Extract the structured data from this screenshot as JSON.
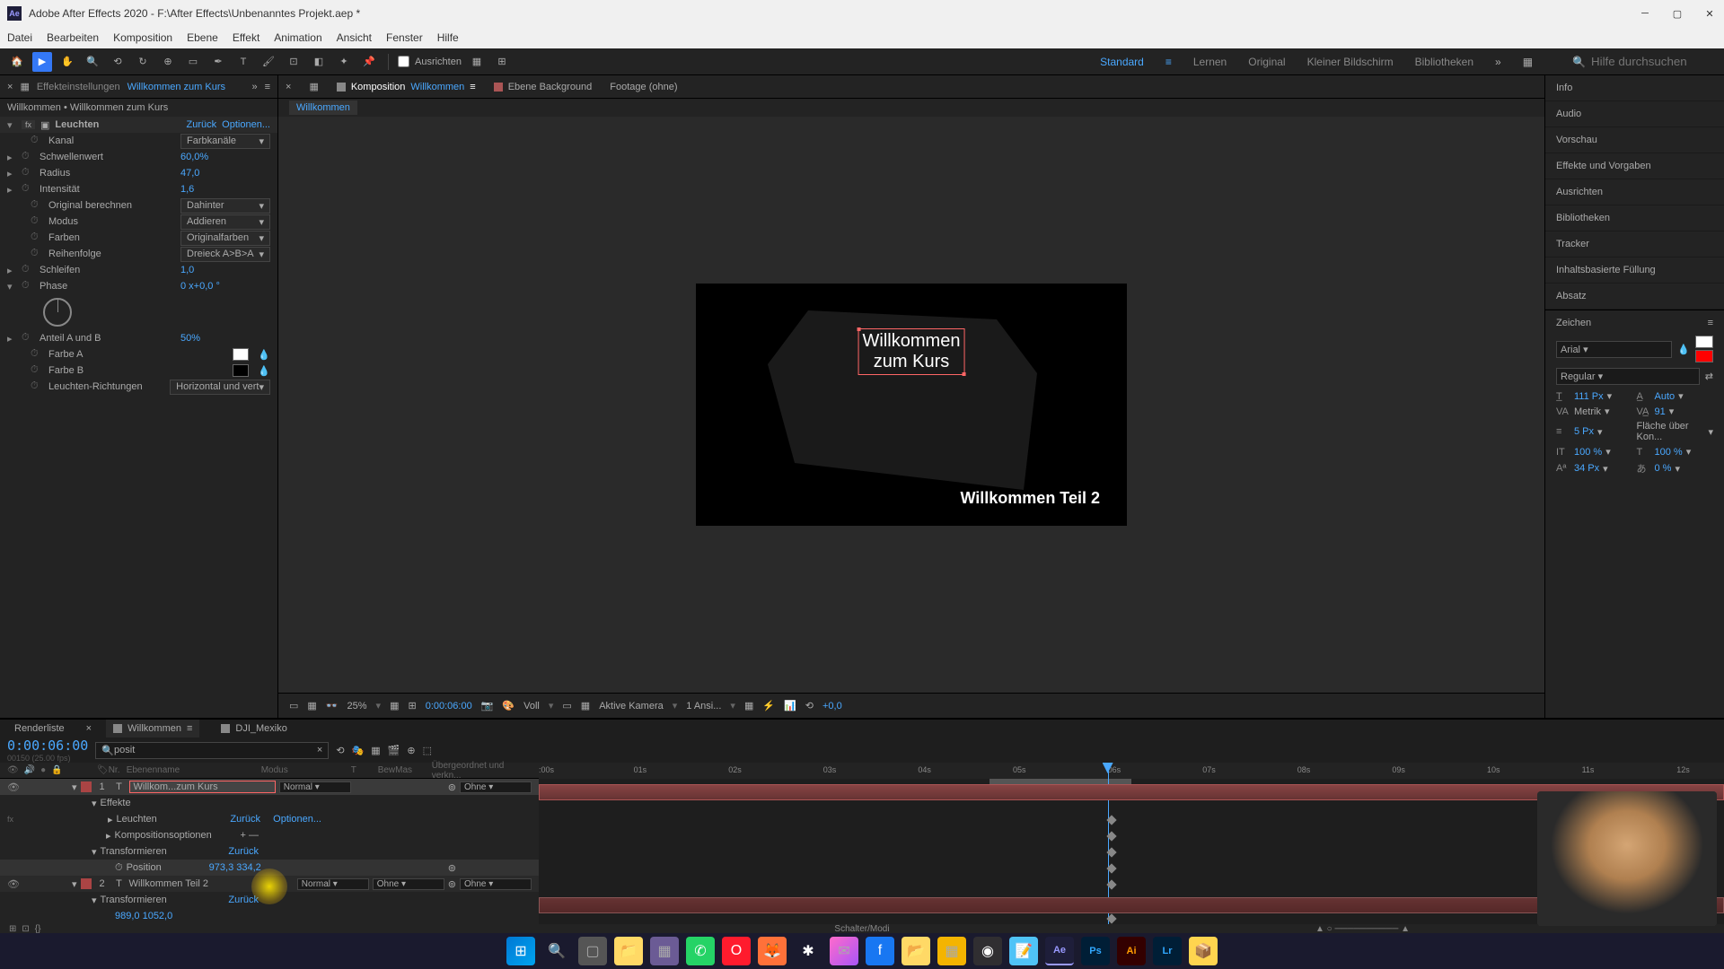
{
  "titlebar": {
    "app": "Adobe After Effects 2020",
    "project": "F:\\After Effects\\Unbenanntes Projekt.aep *"
  },
  "menubar": [
    "Datei",
    "Bearbeiten",
    "Komposition",
    "Ebene",
    "Effekt",
    "Animation",
    "Ansicht",
    "Fenster",
    "Hilfe"
  ],
  "toolbar": {
    "snap_label": "Ausrichten"
  },
  "workspaces": {
    "items": [
      "Standard",
      "Lernen",
      "Original",
      "Kleiner Bildschirm",
      "Bibliotheken"
    ],
    "active": "Standard",
    "search_placeholder": "Hilfe durchsuchen"
  },
  "effect_controls": {
    "tab_label": "Effekteinstellungen",
    "tab_value": "Willkommen zum Kurs",
    "breadcrumb": "Willkommen • Willkommen zum Kurs",
    "effect_name": "Leuchten",
    "reset": "Zurück",
    "options": "Optionen...",
    "props": {
      "kanal": {
        "label": "Kanal",
        "value": "Farbkanäle"
      },
      "schwellenwert": {
        "label": "Schwellenwert",
        "value": "60,0%"
      },
      "radius": {
        "label": "Radius",
        "value": "47,0"
      },
      "intensitaet": {
        "label": "Intensität",
        "value": "1,6"
      },
      "original": {
        "label": "Original berechnen",
        "value": "Dahinter"
      },
      "modus": {
        "label": "Modus",
        "value": "Addieren"
      },
      "farben": {
        "label": "Farben",
        "value": "Originalfarben"
      },
      "reihenfolge": {
        "label": "Reihenfolge",
        "value": "Dreieck A>B>A"
      },
      "schleifen": {
        "label": "Schleifen",
        "value": "1,0"
      },
      "phase": {
        "label": "Phase",
        "value": "0 x+0,0 °"
      },
      "anteil": {
        "label": "Anteil A und B",
        "value": "50%"
      },
      "farbe_a": {
        "label": "Farbe A"
      },
      "farbe_b": {
        "label": "Farbe B"
      },
      "richtungen": {
        "label": "Leuchten-Richtungen",
        "value": "Horizontal und vert"
      }
    }
  },
  "comp_panel": {
    "tabs": [
      {
        "label": "Komposition",
        "value": "Willkommen",
        "active": true
      },
      {
        "label": "Ebene Background",
        "active": false
      },
      {
        "label": "Footage (ohne)",
        "active": false
      }
    ],
    "breadcrumb": "Willkommen",
    "text1_line1": "Willkommen",
    "text1_line2": "zum Kurs",
    "text2": "Willkommen Teil 2",
    "controls": {
      "zoom": "25%",
      "timecode": "0:00:06:00",
      "resolution": "Voll",
      "camera": "Aktive Kamera",
      "views": "1 Ansi...",
      "exposure": "+0,0"
    }
  },
  "right_panels": [
    "Info",
    "Audio",
    "Vorschau",
    "Effekte und Vorgaben",
    "Ausrichten",
    "Bibliotheken",
    "Tracker",
    "Inhaltsbasierte Füllung",
    "Absatz"
  ],
  "character": {
    "title": "Zeichen",
    "font": "Arial",
    "style": "Regular",
    "size": "111 Px",
    "leading": "Auto",
    "kerning": "Metrik",
    "tracking": "91",
    "stroke_width": "5 Px",
    "stroke_opt": "Fläche über Kon...",
    "vscale": "100 %",
    "hscale": "100 %",
    "baseline": "34 Px",
    "tsume": "0 %"
  },
  "timeline": {
    "tabs": [
      {
        "label": "Renderliste",
        "active": false
      },
      {
        "label": "Willkommen",
        "active": true
      },
      {
        "label": "DJI_Mexiko",
        "active": false
      }
    ],
    "timecode": "0:00:06:00",
    "timecode_sub": "00150 (25.00 fps)",
    "search_value": "posit",
    "columns": {
      "nr": "Nr.",
      "name": "Ebenenname",
      "modus": "Modus",
      "t": "T",
      "bewmas": "BewMas",
      "parent": "Übergeordnet und verkn..."
    },
    "ruler_ticks": [
      ":00s",
      "01s",
      "02s",
      "03s",
      "04s",
      "05s",
      "06s",
      "07s",
      "08s",
      "09s",
      "10s",
      "11s",
      "12s"
    ],
    "layers": [
      {
        "num": "1",
        "name": "Willkom...zum Kurs",
        "mode": "Normal",
        "parent": "Ohne",
        "children": {
          "effekte": "Effekte",
          "leuchten": "Leuchten",
          "leuchten_reset": "Zurück",
          "leuchten_opt": "Optionen...",
          "kompopt": "Kompositionsoptionen",
          "transform": "Transformieren",
          "transform_reset": "Zurück",
          "position": "Position",
          "position_val": "973,3 334,2"
        }
      },
      {
        "num": "2",
        "name": "Willkommen Teil 2",
        "mode": "Normal",
        "trackmat": "Ohne",
        "parent": "Ohne",
        "children": {
          "transform": "Transformieren",
          "transform_reset": "Zurück",
          "position_val": "989,0 1052,0"
        }
      }
    ],
    "footer": "Schalter/Modi"
  }
}
